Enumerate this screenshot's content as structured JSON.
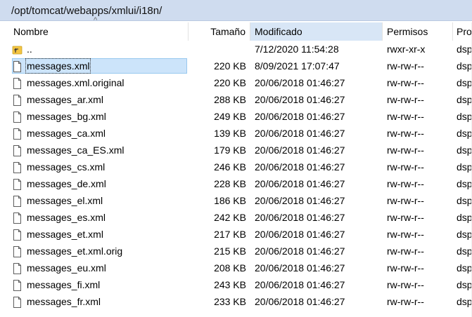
{
  "path": "/opt/tomcat/webapps/xmlui/i18n/",
  "sort_indicator": "^",
  "columns": {
    "name": "Nombre",
    "size": "Tamaño",
    "modified": "Modificado",
    "permissions": "Permisos",
    "owner": "Pro"
  },
  "rows": [
    {
      "icon": "parent-folder-icon",
      "name": "..",
      "size": "",
      "modified": "7/12/2020 11:54:28",
      "permissions": "rwxr-xr-x",
      "owner": "dsp"
    },
    {
      "icon": "file-icon",
      "name": "messages.xml",
      "size": "220 KB",
      "modified": "8/09/2021 17:07:47",
      "permissions": "rw-rw-r--",
      "owner": "dsp",
      "selected": true
    },
    {
      "icon": "file-icon",
      "name": "messages.xml.original",
      "size": "220 KB",
      "modified": "20/06/2018 01:46:27",
      "permissions": "rw-rw-r--",
      "owner": "dsp"
    },
    {
      "icon": "file-icon",
      "name": "messages_ar.xml",
      "size": "288 KB",
      "modified": "20/06/2018 01:46:27",
      "permissions": "rw-rw-r--",
      "owner": "dsp"
    },
    {
      "icon": "file-icon",
      "name": "messages_bg.xml",
      "size": "249 KB",
      "modified": "20/06/2018 01:46:27",
      "permissions": "rw-rw-r--",
      "owner": "dsp"
    },
    {
      "icon": "file-icon",
      "name": "messages_ca.xml",
      "size": "139 KB",
      "modified": "20/06/2018 01:46:27",
      "permissions": "rw-rw-r--",
      "owner": "dsp"
    },
    {
      "icon": "file-icon",
      "name": "messages_ca_ES.xml",
      "size": "179 KB",
      "modified": "20/06/2018 01:46:27",
      "permissions": "rw-rw-r--",
      "owner": "dsp"
    },
    {
      "icon": "file-icon",
      "name": "messages_cs.xml",
      "size": "246 KB",
      "modified": "20/06/2018 01:46:27",
      "permissions": "rw-rw-r--",
      "owner": "dsp"
    },
    {
      "icon": "file-icon",
      "name": "messages_de.xml",
      "size": "228 KB",
      "modified": "20/06/2018 01:46:27",
      "permissions": "rw-rw-r--",
      "owner": "dsp"
    },
    {
      "icon": "file-icon",
      "name": "messages_el.xml",
      "size": "186 KB",
      "modified": "20/06/2018 01:46:27",
      "permissions": "rw-rw-r--",
      "owner": "dsp"
    },
    {
      "icon": "file-icon",
      "name": "messages_es.xml",
      "size": "242 KB",
      "modified": "20/06/2018 01:46:27",
      "permissions": "rw-rw-r--",
      "owner": "dsp"
    },
    {
      "icon": "file-icon",
      "name": "messages_et.xml",
      "size": "217 KB",
      "modified": "20/06/2018 01:46:27",
      "permissions": "rw-rw-r--",
      "owner": "dsp"
    },
    {
      "icon": "file-icon",
      "name": "messages_et.xml.orig",
      "size": "215 KB",
      "modified": "20/06/2018 01:46:27",
      "permissions": "rw-rw-r--",
      "owner": "dsp"
    },
    {
      "icon": "file-icon",
      "name": "messages_eu.xml",
      "size": "208 KB",
      "modified": "20/06/2018 01:46:27",
      "permissions": "rw-rw-r--",
      "owner": "dsp"
    },
    {
      "icon": "file-icon",
      "name": "messages_fi.xml",
      "size": "243 KB",
      "modified": "20/06/2018 01:46:27",
      "permissions": "rw-rw-r--",
      "owner": "dsp"
    },
    {
      "icon": "file-icon",
      "name": "messages_fr.xml",
      "size": "233 KB",
      "modified": "20/06/2018 01:46:27",
      "permissions": "rw-rw-r--",
      "owner": "dsp"
    }
  ]
}
